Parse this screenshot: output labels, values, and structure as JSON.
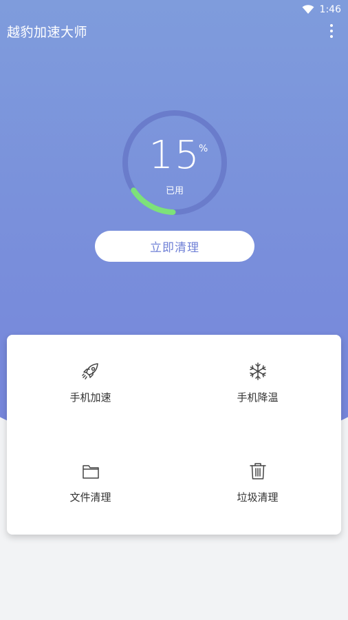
{
  "status_bar": {
    "time": "1:46",
    "wifi_icon": "wifi-icon"
  },
  "app_bar": {
    "title": "越豹加速大师",
    "menu_icon": "more-vert-icon"
  },
  "memory": {
    "percent": "15",
    "percent_sign": "%",
    "used_label": "已用",
    "usage_fraction": 0.15
  },
  "clean_button": {
    "label": "立即清理"
  },
  "features": [
    {
      "label": "手机加速",
      "icon": "rocket-icon"
    },
    {
      "label": "手机降温",
      "icon": "snowflake-icon"
    },
    {
      "label": "文件清理",
      "icon": "folder-icon"
    },
    {
      "label": "垃圾清理",
      "icon": "trash-icon"
    }
  ],
  "colors": {
    "gradient_top": "#7f9cdc",
    "gradient_bottom": "#7685db",
    "ring_track": "#6a7ccb",
    "ring_progress": "#7de27a",
    "button_text": "#6f80d6"
  }
}
